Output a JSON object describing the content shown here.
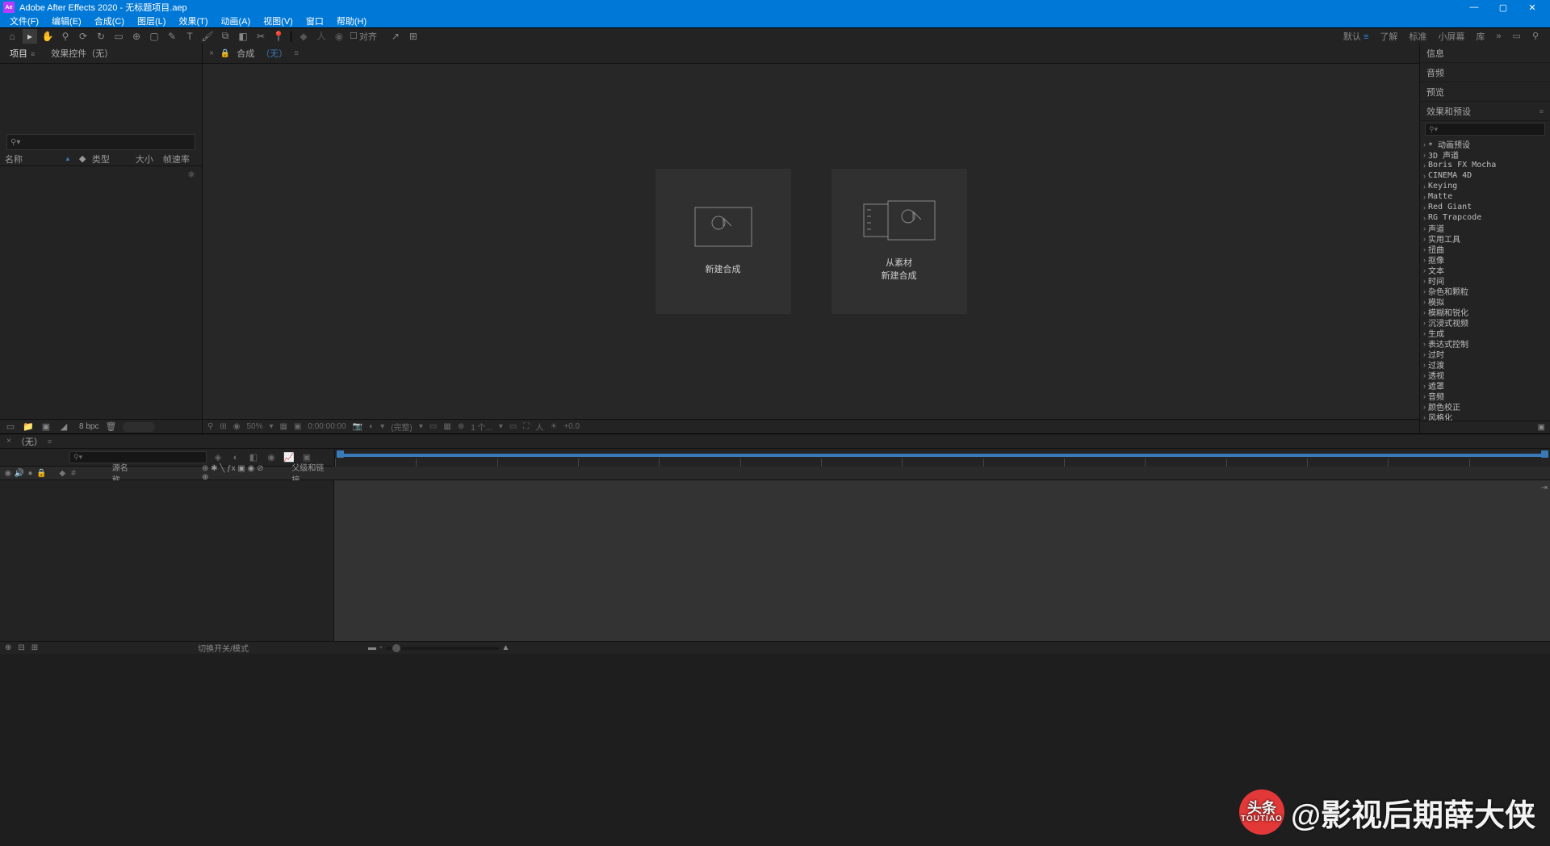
{
  "titlebar": {
    "app_icon": "Ae",
    "title": "Adobe After Effects 2020 - 无标题项目.aep"
  },
  "menubar": [
    "文件(F)",
    "编辑(E)",
    "合成(C)",
    "图层(L)",
    "效果(T)",
    "动画(A)",
    "视图(V)",
    "窗口",
    "帮助(H)"
  ],
  "toolbar": {
    "snap_label": "对齐"
  },
  "workspace": {
    "tabs": [
      "默认",
      "了解",
      "标准",
      "小屏幕",
      "库"
    ],
    "active": 0
  },
  "left_panel": {
    "tabs": [
      "项目",
      "效果控件（无）"
    ],
    "columns": {
      "name": "名称",
      "type": "类型",
      "size": "大小",
      "rate": "帧速率"
    },
    "footer": {
      "bpc": "8 bpc"
    }
  },
  "center_panel": {
    "tab_prefix": "合成",
    "tab_none": "（无）",
    "card1": "新建合成",
    "card2_line1": "从素材",
    "card2_line2": "新建合成",
    "footer": {
      "zoom": "50%",
      "timecode": "0:00:00:00",
      "full": "(完整)",
      "views": "1 个...",
      "exposure": "+0.0"
    }
  },
  "right_panels": {
    "headers": [
      "信息",
      "音频",
      "预览",
      "效果和预设"
    ],
    "effects": [
      "* 动画预设",
      "3D 声道",
      "Boris FX Mocha",
      "CINEMA 4D",
      "Keying",
      "Matte",
      "Red Giant",
      "RG Trapcode",
      "声道",
      "实用工具",
      "扭曲",
      "抠像",
      "文本",
      "时间",
      "杂色和颗粒",
      "模拟",
      "模糊和锐化",
      "沉浸式视频",
      "生成",
      "表达式控制",
      "过时",
      "过渡",
      "透视",
      "遮罩",
      "音频",
      "颜色校正",
      "风格化"
    ]
  },
  "timeline": {
    "tab": "（无）",
    "col_src": "源名称",
    "col_parent": "父级和链接",
    "status_switch": "切换开关/模式"
  },
  "watermark": {
    "logo_top": "头条",
    "logo_bottom": "TOUTIAO",
    "text": "@影视后期薛大侠"
  }
}
